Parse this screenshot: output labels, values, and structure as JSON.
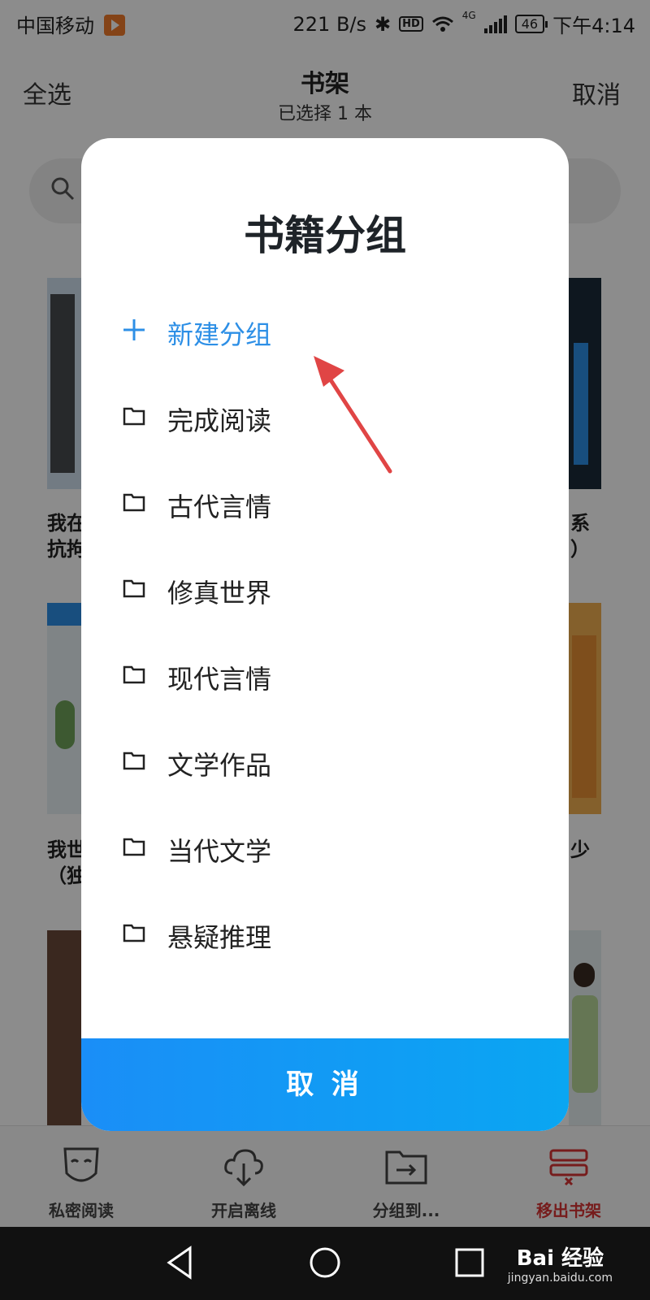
{
  "status_bar": {
    "carrier": "中国移动",
    "speed": "221 B/s",
    "hd": "HD",
    "network": "4G",
    "battery": "46",
    "time": "下午4:14"
  },
  "top_bar": {
    "select_all": "全选",
    "title": "书架",
    "subtitle": "已选择 1 本",
    "cancel": "取消"
  },
  "bookshelf": {
    "left_titles": [
      "我在",
      "抗拘",
      "我世",
      "（独"
    ],
    "right_titles": [
      "系",
      "）",
      "少"
    ]
  },
  "dialog": {
    "title": "书籍分组",
    "new_group": "新建分组",
    "groups": [
      "完成阅读",
      "古代言情",
      "修真世界",
      "现代言情",
      "文学作品",
      "当代文学",
      "悬疑推理"
    ],
    "cancel": "取 消"
  },
  "bottom_nav": {
    "items": [
      {
        "label": "私密阅读",
        "icon": "mask-icon"
      },
      {
        "label": "开启离线",
        "icon": "cloud-download-icon"
      },
      {
        "label": "分组到...",
        "icon": "folder-move-icon"
      },
      {
        "label": "移出书架",
        "icon": "remove-shelf-icon"
      }
    ]
  },
  "watermark": {
    "text": "Bai 经验",
    "url": "jingyan.baidu.com"
  },
  "colors": {
    "accent": "#2d8fe6",
    "danger": "#d83434",
    "button_start": "#1a8ef7",
    "button_end": "#0aa6f2"
  }
}
